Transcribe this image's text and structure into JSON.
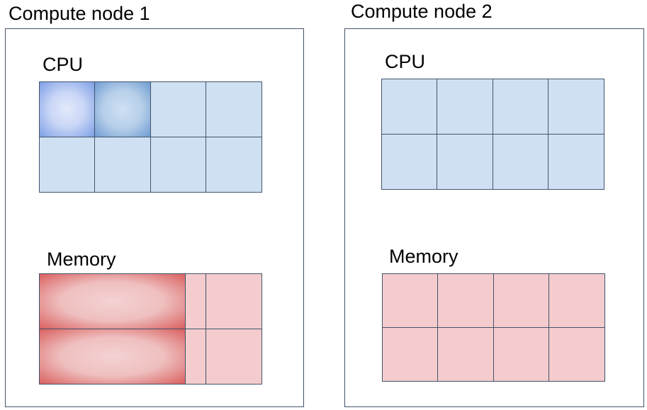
{
  "nodes": [
    {
      "title": "Compute node 1",
      "cpu_label": "CPU",
      "memory_label": "Memory"
    },
    {
      "title": "Compute node 2",
      "cpu_label": "CPU",
      "memory_label": "Memory"
    }
  ],
  "colors": {
    "cpu_fill": "#cfe0f3",
    "cpu_busy": "#7d9fe6",
    "memory_fill": "#f4cccd",
    "memory_busy": "#d9605f",
    "border": "#44546a"
  }
}
